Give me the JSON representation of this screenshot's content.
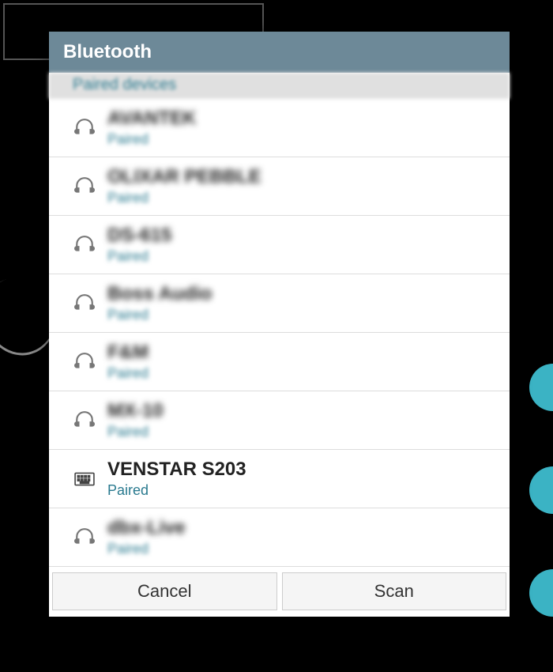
{
  "header": {
    "title": "Bluetooth",
    "section_label": "Paired devices"
  },
  "devices": [
    {
      "name": "AVANTEK",
      "status": "Paired",
      "icon": "headphones",
      "blurred": true
    },
    {
      "name": "OLIXAR PEBBLE",
      "status": "Paired",
      "icon": "headphones",
      "blurred": true
    },
    {
      "name": "DS-615",
      "status": "Paired",
      "icon": "headphones",
      "blurred": true
    },
    {
      "name": "Boss Audio",
      "status": "Paired",
      "icon": "headphones",
      "blurred": true
    },
    {
      "name": "F&M",
      "status": "Paired",
      "icon": "headphones",
      "blurred": true
    },
    {
      "name": "MX-10",
      "status": "Paired",
      "icon": "headphones",
      "blurred": true
    },
    {
      "name": "VENSTAR S203",
      "status": "Paired",
      "icon": "keyboard",
      "blurred": false
    },
    {
      "name": "dbx-Live",
      "status": "Paired",
      "icon": "headphones",
      "blurred": true
    }
  ],
  "buttons": {
    "cancel": "Cancel",
    "scan": "Scan"
  },
  "colors": {
    "header_bg": "#6d8998",
    "accent_text": "#2a7a8f",
    "bg_circle": "#3bb3c4"
  }
}
